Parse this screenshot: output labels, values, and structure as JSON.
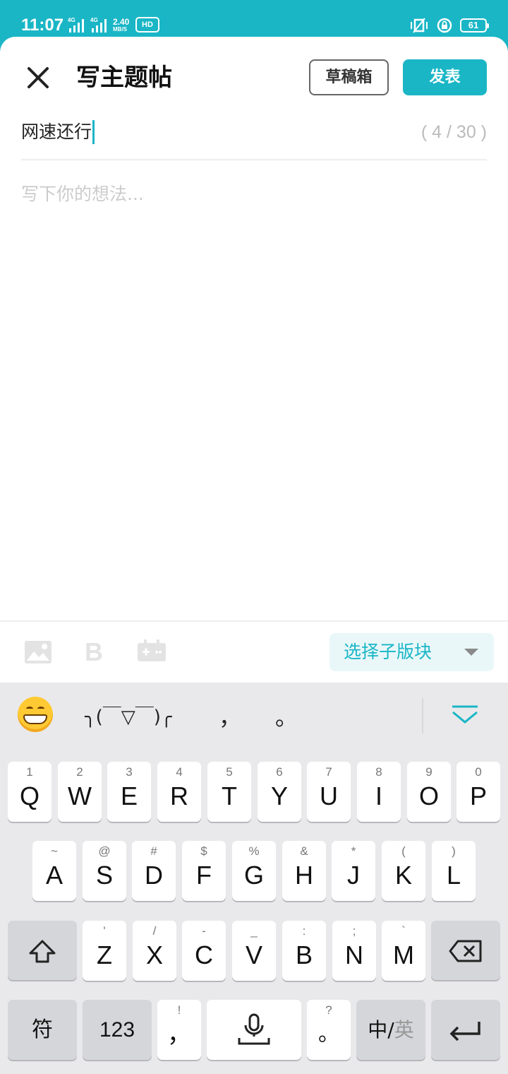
{
  "status": {
    "time": "11:07",
    "signal1": "4G",
    "signal2": "4G",
    "speed_value": "2.40",
    "speed_unit": "MB/S",
    "hd": "HD",
    "battery": "61"
  },
  "header": {
    "title": "写主题帖",
    "drafts_label": "草稿箱",
    "publish_label": "发表"
  },
  "editor": {
    "title_value": "网速还行",
    "counter": "( 4 / 30 )",
    "body_placeholder": "写下你的想法..."
  },
  "toolbar": {
    "icons": [
      "image-icon",
      "bold-icon",
      "gamepad-icon"
    ],
    "board_select_label": "选择子版块"
  },
  "keyboard": {
    "candidates": {
      "emoji": "grinning-emoji",
      "kaomoji": "╮(￣▽￣)╭",
      "comma": "，",
      "period": "。"
    },
    "row1": [
      {
        "main": "Q",
        "sub": "1"
      },
      {
        "main": "W",
        "sub": "2"
      },
      {
        "main": "E",
        "sub": "3"
      },
      {
        "main": "R",
        "sub": "4"
      },
      {
        "main": "T",
        "sub": "5"
      },
      {
        "main": "Y",
        "sub": "6"
      },
      {
        "main": "U",
        "sub": "7"
      },
      {
        "main": "I",
        "sub": "8"
      },
      {
        "main": "O",
        "sub": "9"
      },
      {
        "main": "P",
        "sub": "0"
      }
    ],
    "row2": [
      {
        "main": "A",
        "sub": "~"
      },
      {
        "main": "S",
        "sub": "@"
      },
      {
        "main": "D",
        "sub": "#"
      },
      {
        "main": "F",
        "sub": "$"
      },
      {
        "main": "G",
        "sub": "%"
      },
      {
        "main": "H",
        "sub": "&"
      },
      {
        "main": "J",
        "sub": "*"
      },
      {
        "main": "K",
        "sub": "("
      },
      {
        "main": "L",
        "sub": ")"
      }
    ],
    "row3": [
      {
        "main": "Z",
        "sub": "'"
      },
      {
        "main": "X",
        "sub": "/"
      },
      {
        "main": "C",
        "sub": "-"
      },
      {
        "main": "V",
        "sub": "_"
      },
      {
        "main": "B",
        "sub": ":"
      },
      {
        "main": "N",
        "sub": ";"
      },
      {
        "main": "M",
        "sub": "`"
      }
    ],
    "symbols_label": "符",
    "numbers_label": "123",
    "comma_key": {
      "main": "，",
      "sub": "!"
    },
    "period_key": {
      "main": "。",
      "sub": "?"
    },
    "lang_primary": "中/",
    "lang_secondary": "英"
  },
  "colors": {
    "accent": "#1ab6c6",
    "keyboard_bg": "#e9e9eb"
  }
}
